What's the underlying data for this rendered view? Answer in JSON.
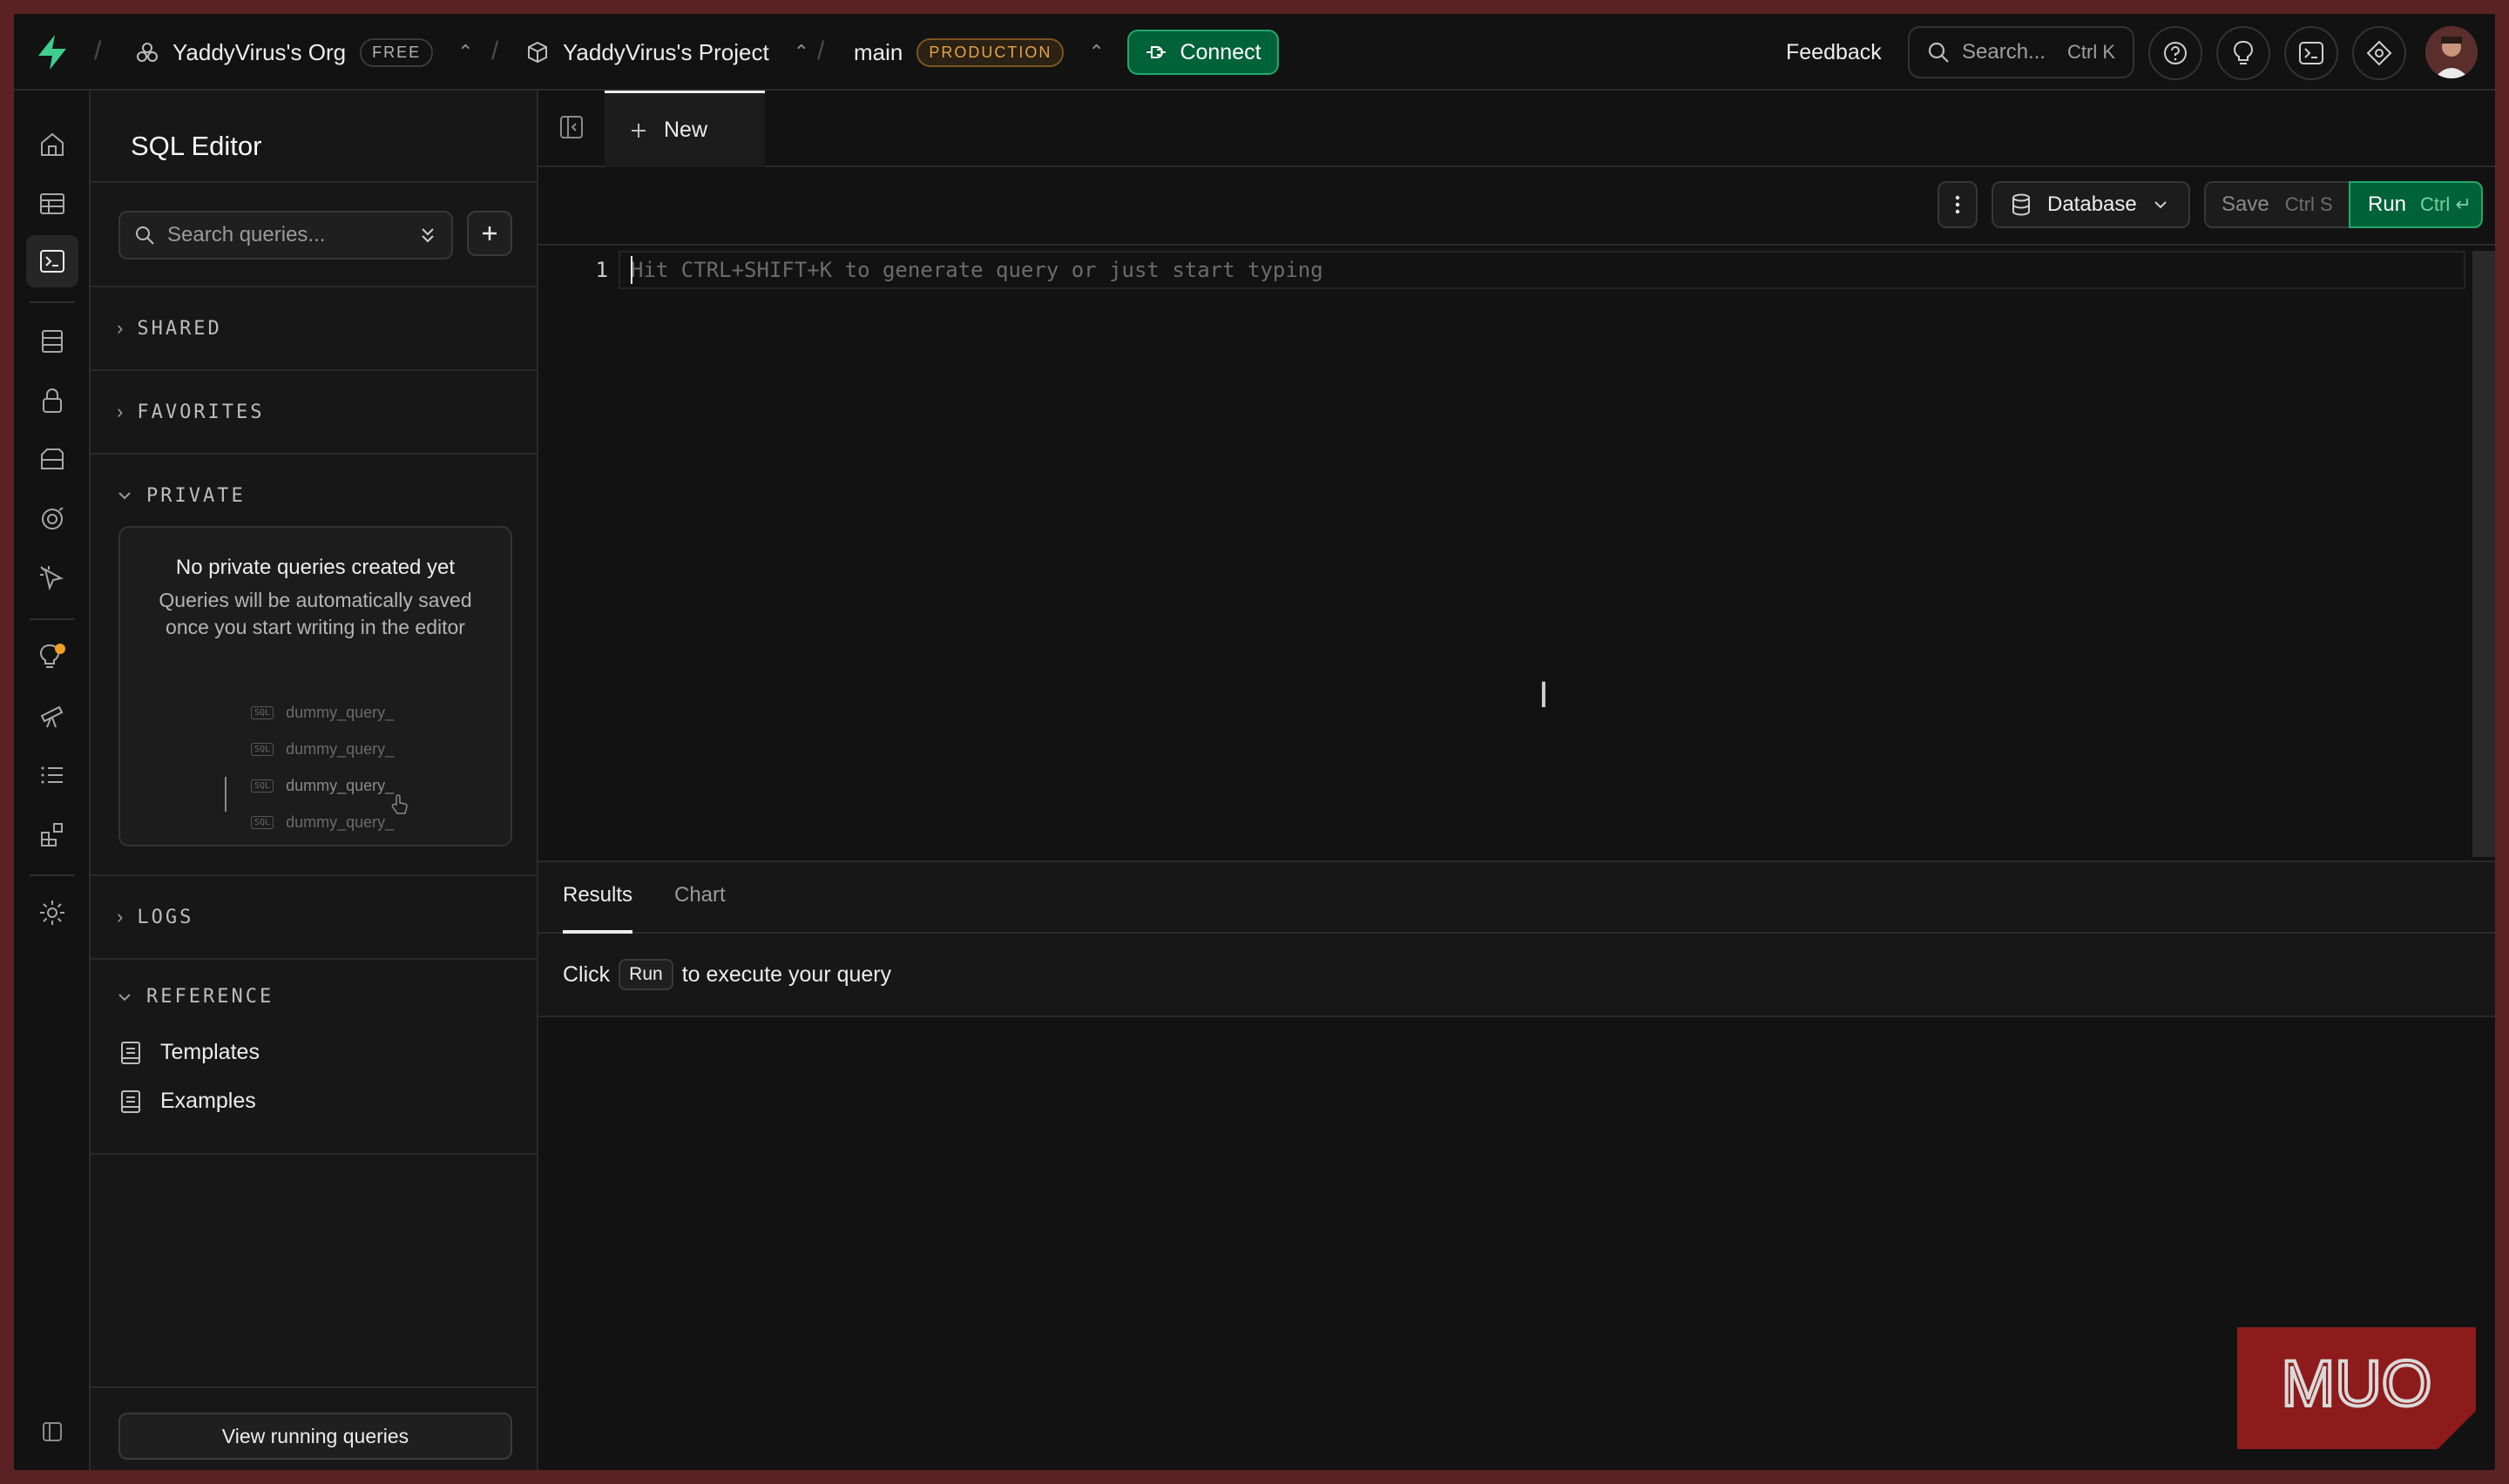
{
  "topbar": {
    "org_name": "YaddyVirus's Org",
    "org_badge": "FREE",
    "project_name": "YaddyVirus's Project",
    "branch_name": "main",
    "branch_badge": "PRODUCTION",
    "connect_label": "Connect",
    "feedback_label": "Feedback",
    "search_placeholder": "Search...",
    "search_shortcut": "Ctrl K"
  },
  "sidebar": {
    "title": "SQL Editor",
    "search_placeholder": "Search queries...",
    "sections": {
      "shared": "SHARED",
      "favorites": "FAVORITES",
      "private": "PRIVATE",
      "logs": "LOGS",
      "reference": "REFERENCE"
    },
    "empty_title": "No private queries created yet",
    "empty_desc": "Queries will be automatically saved once you start writing in the editor",
    "dummy_tag": "SQL",
    "dummy_queries": [
      "dummy_query_",
      "dummy_query_",
      "dummy_query_",
      "dummy_query_"
    ],
    "reference_items": [
      "Templates",
      "Examples"
    ],
    "view_running_label": "View running queries"
  },
  "tabs": {
    "new_label": "New"
  },
  "toolbar": {
    "database_label": "Database",
    "save_label": "Save",
    "save_shortcut": "Ctrl S",
    "run_label": "Run",
    "run_shortcut": "Ctrl ↵"
  },
  "editor": {
    "line_number": "1",
    "placeholder": "Hit CTRL+SHIFT+K to generate query or just start typing"
  },
  "results": {
    "tabs": [
      "Results",
      "Chart"
    ],
    "msg_before": "Click",
    "msg_kbd": "Run",
    "msg_after": "to execute your query"
  },
  "watermark": "MUO",
  "colors": {
    "accent_green": "#006239",
    "accent_green_border": "#23a76a",
    "production_badge": "#e5a449",
    "background": "#121212"
  }
}
